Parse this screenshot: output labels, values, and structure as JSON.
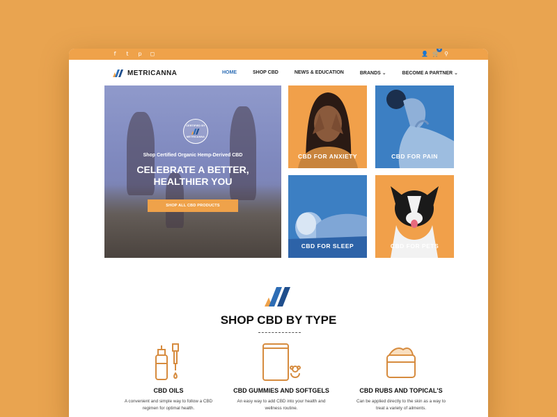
{
  "topbar": {
    "social": [
      {
        "icon": "facebook-icon",
        "glyph": "f"
      },
      {
        "icon": "twitter-icon",
        "glyph": "t"
      },
      {
        "icon": "pinterest-icon",
        "glyph": "p"
      },
      {
        "icon": "instagram-icon",
        "glyph": "◻"
      }
    ],
    "cart_count": "0"
  },
  "header": {
    "brand": "METRICANNA",
    "nav": [
      {
        "label": "HOME",
        "active": true
      },
      {
        "label": "SHOP CBD",
        "active": false
      },
      {
        "label": "NEWS & EDUCATION",
        "active": false
      },
      {
        "label": "BRANDS ⌄",
        "active": false
      },
      {
        "label": "BECOME A PARTNER ⌄",
        "active": false
      }
    ]
  },
  "hero": {
    "badge_top": "CERTIFIED BY",
    "badge_bottom": "METRICANNA",
    "kicker": "Shop Certified Organic Hemp-Derived CBD",
    "title_line1": "CELEBRATE A BETTER,",
    "title_line2": "HEALTHIER YOU",
    "button": "SHOP ALL CBD PRODUCTS"
  },
  "tiles": [
    {
      "label": "CBD FOR ANXIETY"
    },
    {
      "label": "CBD FOR PAIN"
    },
    {
      "label": "CBD FOR SLEEP"
    },
    {
      "label": "CBD FOR PETS"
    }
  ],
  "shop_by_type": {
    "title": "SHOP CBD BY TYPE",
    "categories": [
      {
        "title": "CBD OILS",
        "desc_line1": "A convenient and simple way to follow a CBD",
        "desc_line2": "regimen for optimal health."
      },
      {
        "title": "CBD GUMMIES AND SOFTGELS",
        "desc_line1": "An easy way to add CBD into your health and",
        "desc_line2": "wellness routine."
      },
      {
        "title": "CBD RUBS AND TOPICAL'S",
        "desc_line1": "Can be applied directly to the skin as a way to",
        "desc_line2": "treat a variety of ailments."
      }
    ]
  },
  "colors": {
    "background": "#E9A450",
    "accent_orange": "#EFA24A",
    "accent_blue": "#2D6DB5"
  }
}
